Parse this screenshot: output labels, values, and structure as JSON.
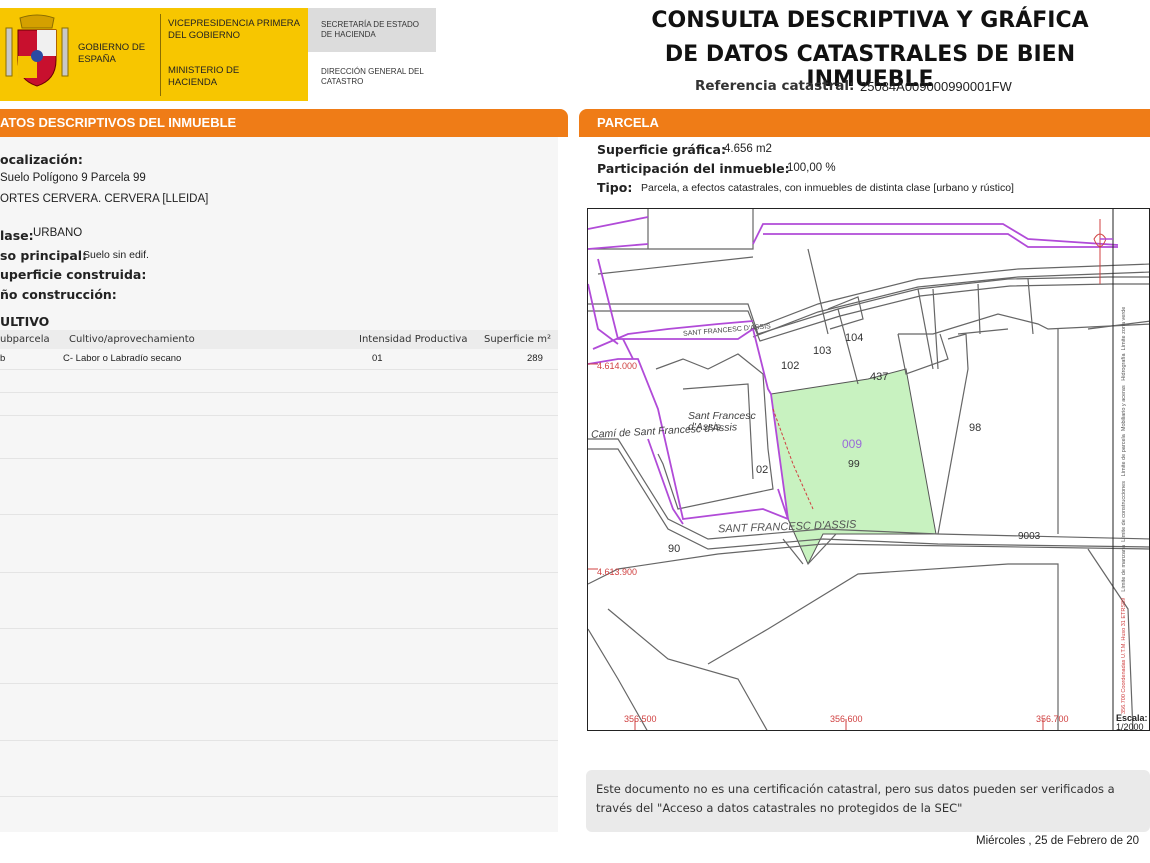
{
  "header": {
    "gobierno": "GOBIERNO DE ESPAÑA",
    "vicepresidencia": "VICEPRESIDENCIA PRIMERA DEL GOBIERNO",
    "ministerio": "MINISTERIO DE HACIENDA",
    "secretaria": "SECRETARÍA DE ESTADO DE HACIENDA",
    "direccion": "DIRECCIÓN GENERAL DEL CATASTRO",
    "title_line1": "CONSULTA DESCRIPTIVA Y GRÁFICA",
    "title_line2": "DE DATOS CATASTRALES DE BIEN INMUEBLE",
    "ref_label": "Referencia catastral:",
    "ref_value": "25084A009000990001FW"
  },
  "left": {
    "section_title": "ATOS DESCRIPTIVOS DEL INMUEBLE",
    "localizacion_label": "ocalización:",
    "loc_line1": "Suelo Polígono 9 Parcela 99",
    "loc_line2": "ORTES CERVERA. CERVERA [LLEIDA]",
    "clase_label": "lase:",
    "clase_value": "URBANO",
    "uso_label": "so principal:",
    "uso_value": "Suelo sin edif.",
    "superficie_label": "uperficie construida:",
    "anio_label": "ño construcción:",
    "cultivo_title": "ULTIVO",
    "table_headers": [
      "ubparcela",
      "Cultivo/aprovechamiento",
      "Intensidad Productiva",
      "Superficie m²"
    ],
    "table_rows": [
      [
        "b",
        "C- Labor o Labradío secano",
        "01",
        "289"
      ]
    ]
  },
  "right": {
    "section_title": "PARCELA",
    "sup_grafica_label": "Superficie gráfica:",
    "sup_grafica_value": "4.656 m2",
    "participacion_label": "Participación del inmueble:",
    "participacion_value": "100,00 %",
    "tipo_label": "Tipo:",
    "tipo_value": "Parcela, a efectos catastrales, con inmuebles de distinta clase [urbano y rústico]"
  },
  "map": {
    "labels": {
      "p102": "102",
      "p103": "103",
      "p104": "104",
      "p437": "437",
      "p98": "98",
      "p02": "02",
      "p90": "90",
      "p9003": "9003",
      "p009": "009",
      "p99": "99",
      "sant_francesc_assis_top": "SANT FRANCESC D'ASSIS",
      "sant_francesc_road": "SANT FRANCESC D'ASSIS",
      "sant_francesc_assis_small": "Sant Francesc d'Assis",
      "cami_sant_francesc": "Camí de Sant Francesc d'Assis",
      "coord_y1": "4.614.000",
      "coord_y2": "4.613.900",
      "coord_x1": "356.500",
      "coord_x2": "356.600",
      "coord_x3": "356.700"
    },
    "legend": [
      "Límite de manzana",
      "Límite de parcela",
      "Límite de construcciones",
      "Mobiliario y aceras",
      "Límite zona verde",
      "Hidrografía"
    ],
    "legend_coords": "356.700 Coordenadas U.T.M. Huso 31 ETRS89",
    "escala_label": "Escala:",
    "escala_value": "1/2000",
    "parcel_color": "#c8f2c0",
    "boundary_color": "#b14bd8"
  },
  "footer": {
    "note": "Este documento no es una certificación catastral, pero sus datos pueden ser verificados a través del \"Acceso a datos catastrales no protegidos de la SEC\"",
    "date": "Miércoles , 25 de Febrero de 20"
  },
  "colors": {
    "orange": "#ef7c17",
    "yellow": "#f7c600"
  }
}
